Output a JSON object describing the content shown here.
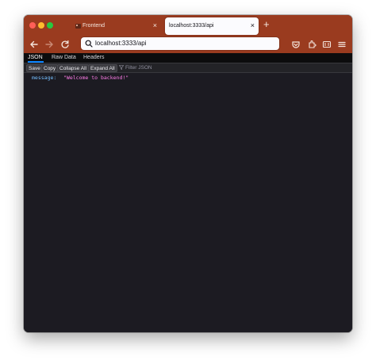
{
  "browser": {
    "tabs": [
      {
        "label": "Frontend",
        "active": false
      },
      {
        "label": "localhost:3333/api",
        "active": true
      }
    ],
    "address": {
      "url": "localhost:3333/api"
    },
    "icons": {
      "back": "arrow-left-icon",
      "forward": "arrow-right-icon",
      "reload": "reload-icon",
      "new_tab": "plus-icon",
      "pocket": "pocket-icon",
      "extensions": "extensions-icon",
      "reader": "reader-icon",
      "menu": "hamburger-menu-icon"
    },
    "colors": {
      "chrome": "#9a3b1f",
      "active_tab": "#fbfbfe"
    }
  },
  "viewer": {
    "tabs": [
      {
        "label": "JSON",
        "active": true
      },
      {
        "label": "Raw Data",
        "active": false
      },
      {
        "label": "Headers",
        "active": false
      }
    ],
    "toolbar": {
      "save": "Save",
      "copy": "Copy",
      "collapse_all": "Collapse All",
      "expand_all": "Expand All",
      "filter_placeholder": "Filter JSON"
    },
    "rows": [
      {
        "key": "message:",
        "value": "\"Welcome to backend!\""
      }
    ]
  }
}
